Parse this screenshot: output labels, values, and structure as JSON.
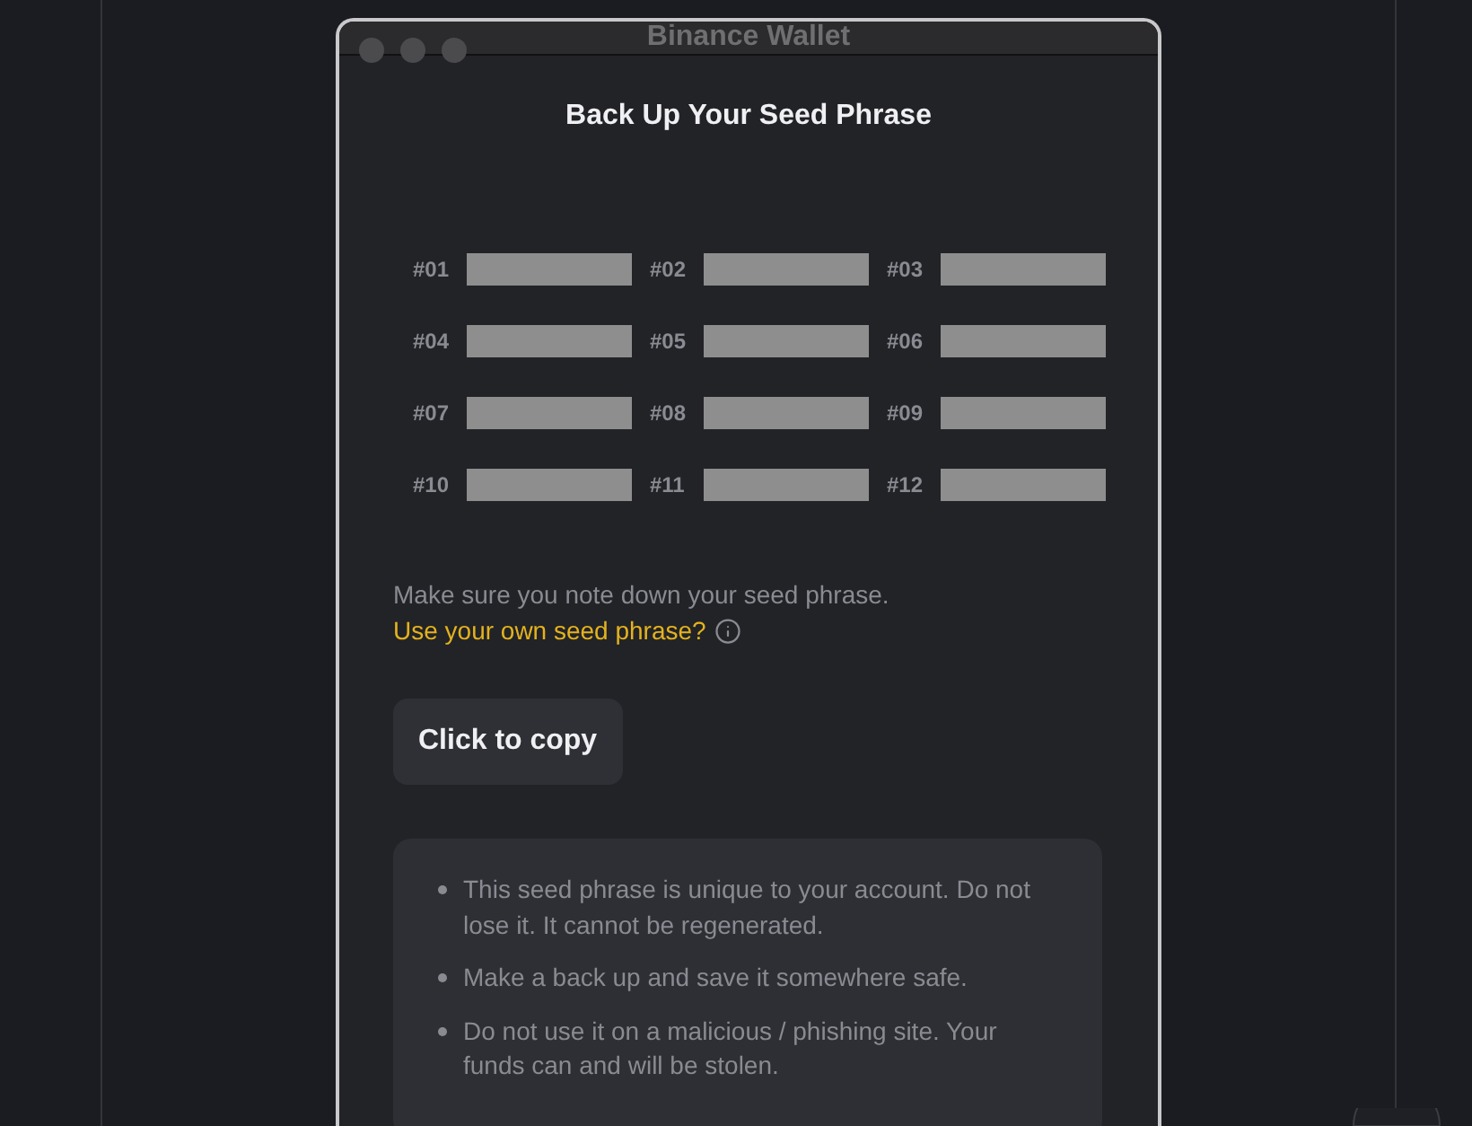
{
  "window": {
    "title": "Binance Wallet"
  },
  "heading": "Back Up Your Seed Phrase",
  "seed_words": [
    {
      "label": "#01"
    },
    {
      "label": "#02"
    },
    {
      "label": "#03"
    },
    {
      "label": "#04"
    },
    {
      "label": "#05"
    },
    {
      "label": "#06"
    },
    {
      "label": "#07"
    },
    {
      "label": "#08"
    },
    {
      "label": "#09"
    },
    {
      "label": "#10"
    },
    {
      "label": "#11"
    },
    {
      "label": "#12"
    }
  ],
  "note": "Make sure you note down your seed phrase.",
  "own_phrase_link": "Use your own seed phrase?",
  "copy_button": "Click to copy",
  "warnings": [
    "This seed phrase is unique to your account. Do not lose it. It cannot be regenerated.",
    "Make a back up and save it somewhere safe.",
    "Do not use it on a malicious / phishing site. Your funds can and will be stolen."
  ]
}
